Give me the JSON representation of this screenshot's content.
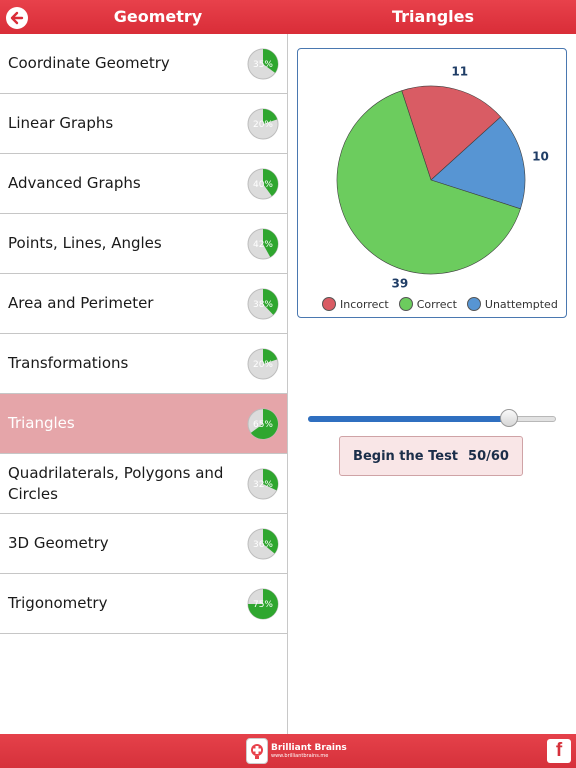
{
  "header": {
    "left_title": "Geometry",
    "right_title": "Triangles"
  },
  "topics": [
    {
      "label": "Coordinate Geometry",
      "progress_label": "35%",
      "progress": 0.35
    },
    {
      "label": "Linear Graphs",
      "progress_label": "20%",
      "progress": 0.2
    },
    {
      "label": "Advanced Graphs",
      "progress_label": "40%",
      "progress": 0.4
    },
    {
      "label": "Points, Lines, Angles",
      "progress_label": "42%",
      "progress": 0.42
    },
    {
      "label": "Area and Perimeter",
      "progress_label": "38%",
      "progress": 0.38
    },
    {
      "label": "Transformations",
      "progress_label": "20%",
      "progress": 0.2
    },
    {
      "label": "Triangles",
      "progress_label": "65%",
      "progress": 0.65,
      "selected": true
    },
    {
      "label": "Quadrilaterals, Polygons and Circles",
      "progress_label": "32%",
      "progress": 0.32
    },
    {
      "label": "3D Geometry",
      "progress_label": "36%",
      "progress": 0.36
    },
    {
      "label": "Trigonometry",
      "progress_label": "75%",
      "progress": 0.75
    }
  ],
  "chart_data": {
    "type": "pie",
    "slices": [
      {
        "name": "Incorrect",
        "value": 11,
        "color": "#d95c64"
      },
      {
        "name": "Unattempted",
        "value": 10,
        "color": "#5795d3"
      },
      {
        "name": "Correct",
        "value": 39,
        "color": "#6ccc5e"
      }
    ],
    "legend": [
      "Incorrect",
      "Correct",
      "Unattempted"
    ],
    "legend_placement": "bottom"
  },
  "slider": {
    "value": 50,
    "max": 60
  },
  "test_button": {
    "label": "Begin the Test",
    "count": "50/60"
  },
  "footer": {
    "brand_name": "Brilliant Brains",
    "brand_url": "www.brilliantbrains.me",
    "facebook_label": "f"
  },
  "colors": {
    "accent_red": "#d92d38",
    "progress_green": "#2fa62f",
    "selected_row": "#e5a5a9"
  }
}
